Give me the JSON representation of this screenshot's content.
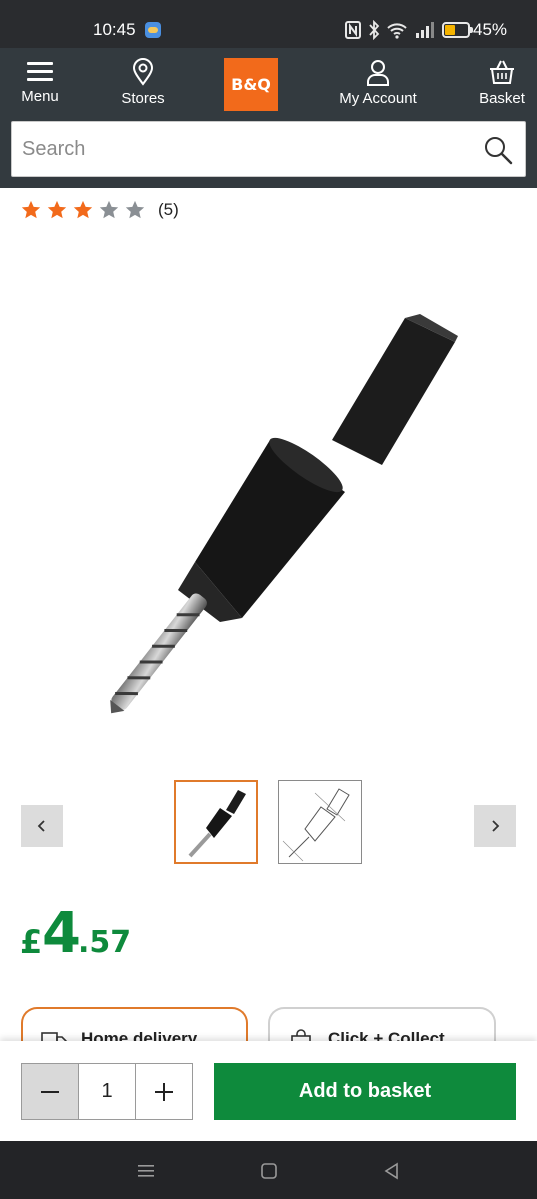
{
  "status": {
    "time": "10:45",
    "battery_pct": "45%",
    "battery_level": 0.45,
    "icons": [
      "nfc-icon",
      "bluetooth-icon",
      "wifi-icon",
      "signal-icon"
    ]
  },
  "header": {
    "logo_text": "B&Q",
    "brand_color": "#f26a1b",
    "nav": {
      "menu": "Menu",
      "stores": "Stores",
      "account": "My Account",
      "basket": "Basket"
    },
    "search_placeholder": "Search"
  },
  "product": {
    "rating_stars": 3,
    "rating_max": 5,
    "rating_count": "(5)",
    "price": {
      "currency": "£",
      "whole": "4",
      "pence": ".57"
    },
    "price_color": "#0e8a3c",
    "thumbnails": [
      "thumbnail-drill-bit-photo",
      "thumbnail-drill-bit-diagram"
    ],
    "selected_thumbnail": 0
  },
  "fulfilment": {
    "home_delivery": "Home delivery",
    "click_collect": "Click + Collect"
  },
  "purchase": {
    "quantity": "1",
    "add_to_basket": "Add to basket",
    "button_color": "#0e8a3c"
  }
}
